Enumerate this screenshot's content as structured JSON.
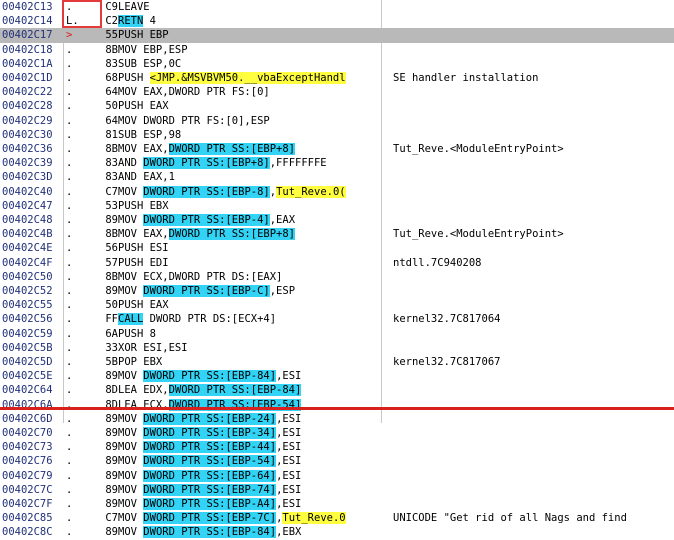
{
  "rows": [
    {
      "addr": "00402C13",
      "mark": ".",
      "hex": "C9",
      "parts": [
        {
          "t": "LEAVE"
        }
      ],
      "comment": ""
    },
    {
      "addr": "00402C14",
      "mark": "L.",
      "hex": "C2",
      "parts": [
        {
          "t": "RETN",
          "hl": "cyan"
        },
        {
          "t": " 4"
        }
      ],
      "comment": ""
    },
    {
      "addr": "00402C17",
      "mark": ">",
      "hex": "55",
      "parts": [
        {
          "t": "PUSH EBP"
        }
      ],
      "comment": ""
    },
    {
      "addr": "00402C18",
      "mark": ".",
      "hex": "8B",
      "parts": [
        {
          "t": "MOV EBP,ESP"
        }
      ],
      "comment": ""
    },
    {
      "addr": "00402C1A",
      "mark": ".",
      "hex": "83",
      "parts": [
        {
          "t": "SUB ESP,0C"
        }
      ],
      "comment": ""
    },
    {
      "addr": "00402C1D",
      "mark": ".",
      "hex": "68",
      "parts": [
        {
          "t": "PUSH "
        },
        {
          "t": "<JMP.&MSVBVM50.__vbaExceptHandl",
          "hl": "yellow"
        }
      ],
      "comment": "SE handler installation"
    },
    {
      "addr": "00402C22",
      "mark": ".",
      "hex": "64",
      "parts": [
        {
          "t": "MOV EAX,DWORD PTR FS:[0]"
        }
      ],
      "comment": ""
    },
    {
      "addr": "00402C28",
      "mark": ".",
      "hex": "50",
      "parts": [
        {
          "t": "PUSH EAX"
        }
      ],
      "comment": ""
    },
    {
      "addr": "00402C29",
      "mark": ".",
      "hex": "64",
      "parts": [
        {
          "t": "MOV DWORD PTR FS:[0],ESP"
        }
      ],
      "comment": ""
    },
    {
      "addr": "00402C30",
      "mark": ".",
      "hex": "81",
      "parts": [
        {
          "t": "SUB ESP,98"
        }
      ],
      "comment": ""
    },
    {
      "addr": "00402C36",
      "mark": ".",
      "hex": "8B",
      "parts": [
        {
          "t": "MOV EAX,"
        },
        {
          "t": "DWORD PTR SS:[EBP+8]",
          "hl": "cyan"
        }
      ],
      "comment": "Tut_Reve.<ModuleEntryPoint>"
    },
    {
      "addr": "00402C39",
      "mark": ".",
      "hex": "83",
      "parts": [
        {
          "t": "AND "
        },
        {
          "t": "DWORD PTR SS:[EBP+8]",
          "hl": "cyan"
        },
        {
          "t": ",FFFFFFFE"
        }
      ],
      "comment": ""
    },
    {
      "addr": "00402C3D",
      "mark": ".",
      "hex": "83",
      "parts": [
        {
          "t": "AND EAX,1"
        }
      ],
      "comment": ""
    },
    {
      "addr": "00402C40",
      "mark": ".",
      "hex": "C7",
      "parts": [
        {
          "t": "MOV "
        },
        {
          "t": "DWORD PTR SS:[EBP-8]",
          "hl": "cyan"
        },
        {
          "t": ","
        },
        {
          "t": "Tut_Reve.0(",
          "hl": "yellow"
        }
      ],
      "comment": ""
    },
    {
      "addr": "00402C47",
      "mark": ".",
      "hex": "53",
      "parts": [
        {
          "t": "PUSH EBX"
        }
      ],
      "comment": ""
    },
    {
      "addr": "00402C48",
      "mark": ".",
      "hex": "89",
      "parts": [
        {
          "t": "MOV "
        },
        {
          "t": "DWORD PTR SS:[EBP-4]",
          "hl": "cyan"
        },
        {
          "t": ",EAX"
        }
      ],
      "comment": ""
    },
    {
      "addr": "00402C4B",
      "mark": ".",
      "hex": "8B",
      "parts": [
        {
          "t": "MOV EAX,"
        },
        {
          "t": "DWORD PTR SS:[EBP+8]",
          "hl": "cyan"
        }
      ],
      "comment": "Tut_Reve.<ModuleEntryPoint>"
    },
    {
      "addr": "00402C4E",
      "mark": ".",
      "hex": "56",
      "parts": [
        {
          "t": "PUSH ESI"
        }
      ],
      "comment": ""
    },
    {
      "addr": "00402C4F",
      "mark": ".",
      "hex": "57",
      "parts": [
        {
          "t": "PUSH EDI"
        }
      ],
      "comment": "ntdll.7C940208"
    },
    {
      "addr": "00402C50",
      "mark": ".",
      "hex": "8B",
      "parts": [
        {
          "t": "MOV ECX,DWORD PTR DS:[EAX]"
        }
      ],
      "comment": ""
    },
    {
      "addr": "00402C52",
      "mark": ".",
      "hex": "89",
      "parts": [
        {
          "t": "MOV "
        },
        {
          "t": "DWORD PTR SS:[EBP-C]",
          "hl": "cyan"
        },
        {
          "t": ",ESP"
        }
      ],
      "comment": ""
    },
    {
      "addr": "00402C55",
      "mark": ".",
      "hex": "50",
      "parts": [
        {
          "t": "PUSH EAX"
        }
      ],
      "comment": ""
    },
    {
      "addr": "00402C56",
      "mark": ".",
      "hex": "FF",
      "parts": [
        {
          "t": "CALL",
          "hl": "cyan"
        },
        {
          "t": " DWORD PTR DS:[ECX+4]"
        }
      ],
      "comment": "kernel32.7C817064"
    },
    {
      "addr": "00402C59",
      "mark": ".",
      "hex": "6A",
      "parts": [
        {
          "t": "PUSH 8"
        }
      ],
      "comment": ""
    },
    {
      "addr": "00402C5B",
      "mark": ".",
      "hex": "33",
      "parts": [
        {
          "t": "XOR ESI,ESI"
        }
      ],
      "comment": ""
    },
    {
      "addr": "00402C5D",
      "mark": ".",
      "hex": "5B",
      "parts": [
        {
          "t": "POP EBX"
        }
      ],
      "comment": "kernel32.7C817067"
    },
    {
      "addr": "00402C5E",
      "mark": ".",
      "hex": "89",
      "parts": [
        {
          "t": "MOV "
        },
        {
          "t": "DWORD PTR SS:[EBP-84]",
          "hl": "cyan"
        },
        {
          "t": ",ESI"
        }
      ],
      "comment": ""
    },
    {
      "addr": "00402C64",
      "mark": ".",
      "hex": "8D",
      "parts": [
        {
          "t": "LEA EDX,"
        },
        {
          "t": "DWORD PTR SS:[EBP-84]",
          "hl": "cyan"
        }
      ],
      "comment": ""
    },
    {
      "addr": "00402C6A",
      "mark": ".",
      "hex": "8D",
      "parts": [
        {
          "t": "LEA ECX,"
        },
        {
          "t": "DWORD PTR SS:[EBP-54]",
          "hl": "cyan"
        }
      ],
      "comment": ""
    },
    {
      "addr": "00402C6D",
      "mark": ".",
      "hex": "89",
      "parts": [
        {
          "t": "MOV "
        },
        {
          "t": "DWORD PTR SS:[EBP-24]",
          "hl": "cyan"
        },
        {
          "t": ",ESI"
        }
      ],
      "comment": ""
    },
    {
      "addr": "00402C70",
      "mark": ".",
      "hex": "89",
      "parts": [
        {
          "t": "MOV "
        },
        {
          "t": "DWORD PTR SS:[EBP-34]",
          "hl": "cyan"
        },
        {
          "t": ",ESI"
        }
      ],
      "comment": ""
    },
    {
      "addr": "00402C73",
      "mark": ".",
      "hex": "89",
      "parts": [
        {
          "t": "MOV "
        },
        {
          "t": "DWORD PTR SS:[EBP-44]",
          "hl": "cyan"
        },
        {
          "t": ",ESI"
        }
      ],
      "comment": ""
    },
    {
      "addr": "00402C76",
      "mark": ".",
      "hex": "89",
      "parts": [
        {
          "t": "MOV "
        },
        {
          "t": "DWORD PTR SS:[EBP-54]",
          "hl": "cyan"
        },
        {
          "t": ",ESI"
        }
      ],
      "comment": ""
    },
    {
      "addr": "00402C79",
      "mark": ".",
      "hex": "89",
      "parts": [
        {
          "t": "MOV "
        },
        {
          "t": "DWORD PTR SS:[EBP-64]",
          "hl": "cyan"
        },
        {
          "t": ",ESI"
        }
      ],
      "comment": ""
    },
    {
      "addr": "00402C7C",
      "mark": ".",
      "hex": "89",
      "parts": [
        {
          "t": "MOV "
        },
        {
          "t": "DWORD PTR SS:[EBP-74]",
          "hl": "cyan"
        },
        {
          "t": ",ESI"
        }
      ],
      "comment": ""
    },
    {
      "addr": "00402C7F",
      "mark": ".",
      "hex": "89",
      "parts": [
        {
          "t": "MOV "
        },
        {
          "t": "DWORD PTR SS:[EBP-A4]",
          "hl": "cyan"
        },
        {
          "t": ",ESI"
        }
      ],
      "comment": ""
    },
    {
      "addr": "00402C85",
      "mark": ".",
      "hex": "C7",
      "parts": [
        {
          "t": "MOV "
        },
        {
          "t": "DWORD PTR SS:[EBP-7C]",
          "hl": "cyan"
        },
        {
          "t": ","
        },
        {
          "t": "Tut_Reve.0",
          "hl": "yellow"
        }
      ],
      "comment": "UNICODE \"Get rid of all Nags and find"
    },
    {
      "addr": "00402C8C",
      "mark": ".",
      "hex": "89",
      "parts": [
        {
          "t": "MOV "
        },
        {
          "t": "DWORD PTR SS:[EBP-84]",
          "hl": "cyan"
        },
        {
          "t": ",EBX"
        }
      ],
      "comment": ""
    }
  ],
  "selected_address": "00402C17",
  "colors": {
    "highlight_cyan": "#33d3f5",
    "highlight_yellow": "#ffff40",
    "selection": "#b9b9b9",
    "annotation_red": "#e53a3a"
  }
}
